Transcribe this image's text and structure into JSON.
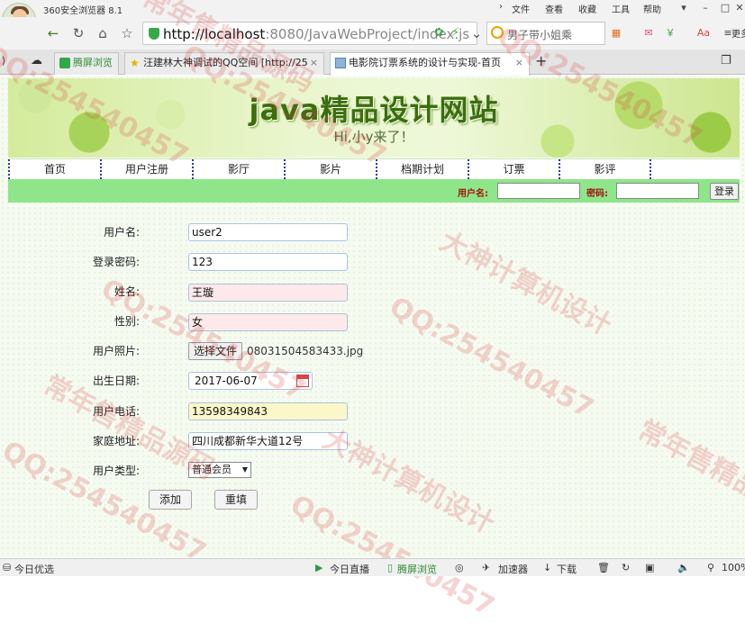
{
  "browser": {
    "title": "360安全浏览器 8.1",
    "menu": [
      "文件",
      "查看",
      "收藏",
      "工具",
      "帮助"
    ],
    "url_host": "http://localhost",
    "url_rest": ":8080/JavaWebProject/index.js",
    "search_text": "男子带小姐乘",
    "more": "更多",
    "tabs": [
      {
        "label": "腾屏浏览"
      },
      {
        "label": "汪建林大神调试的QQ空间 [http://25"
      },
      {
        "label": "电影院订票系统的设计与实现-首页"
      }
    ]
  },
  "site": {
    "title": "java精品设计网站",
    "subtitle": "Hi,小y来了！",
    "nav": [
      "首页",
      "用户注册",
      "影厅",
      "影片",
      "档期计划",
      "订票",
      "影评"
    ],
    "login": {
      "username_label": "用户名:",
      "password_label": "密码:",
      "button": "登录"
    }
  },
  "form": {
    "username_label": "用户名:",
    "username": "user2",
    "password_label": "登录密码:",
    "password": "123",
    "name_label": "姓名:",
    "name": "王璇",
    "gender_label": "性别:",
    "gender": "女",
    "photo_label": "用户照片:",
    "photo_button": "选择文件",
    "photo_file": "08031504583433.jpg",
    "birthday_label": "出生日期:",
    "birthday": "2017-06-07",
    "phone_label": "用户电话:",
    "phone": "13598349843",
    "address_label": "家庭地址:",
    "address": "四川成都新华大道12号",
    "type_label": "用户类型:",
    "type": "普通会员",
    "add_button": "添加",
    "reset_button": "重填"
  },
  "watermark": {
    "qq": "QQ:254540457",
    "brand": "大神计算机设计",
    "shop": "常年售精品源码"
  },
  "statusbar": {
    "left": "今日优选",
    "live": "今日直播",
    "screen": "腾屏浏览",
    "accel": "加速器",
    "download": "下载",
    "zoom": "100%"
  }
}
